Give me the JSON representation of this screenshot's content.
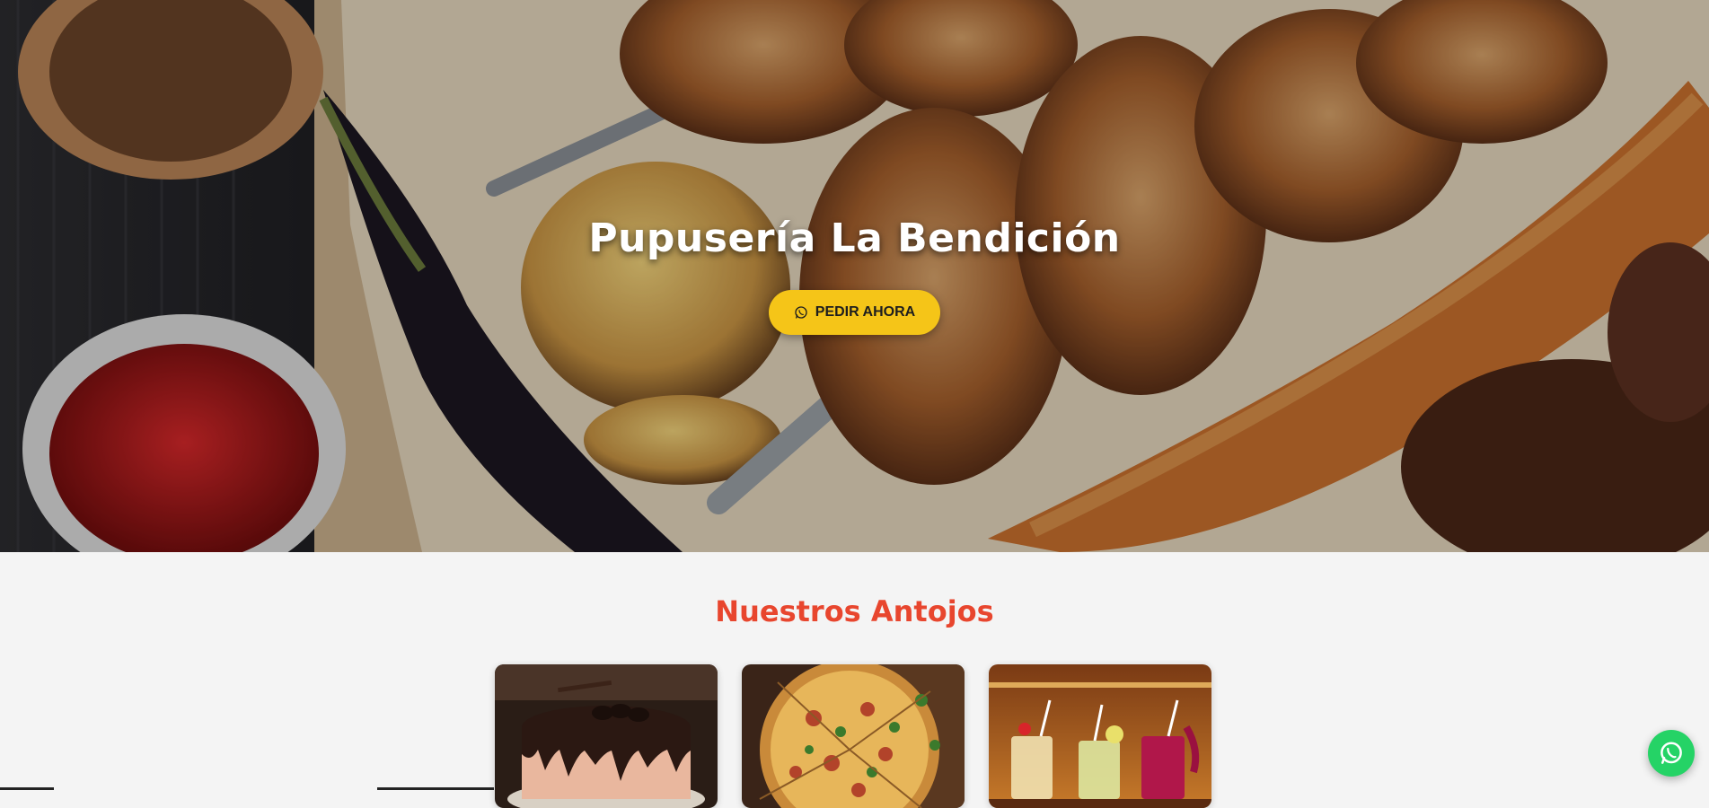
{
  "hero": {
    "title": "Pupusería La Bendición",
    "order_button_label": "PEDIR AHORA",
    "order_button_icon": "whatsapp-icon"
  },
  "section": {
    "title": "Nuestros Antojos"
  },
  "cards": [
    {
      "image": "chocolate-cake-image"
    },
    {
      "image": "pizza-image"
    },
    {
      "image": "cocktails-image"
    }
  ],
  "floating_button": {
    "icon": "whatsapp-icon"
  },
  "colors": {
    "accent_yellow": "#f5c518",
    "section_title_red": "#e8462e",
    "whatsapp_green": "#25d366",
    "page_background": "#f4f4f4"
  }
}
